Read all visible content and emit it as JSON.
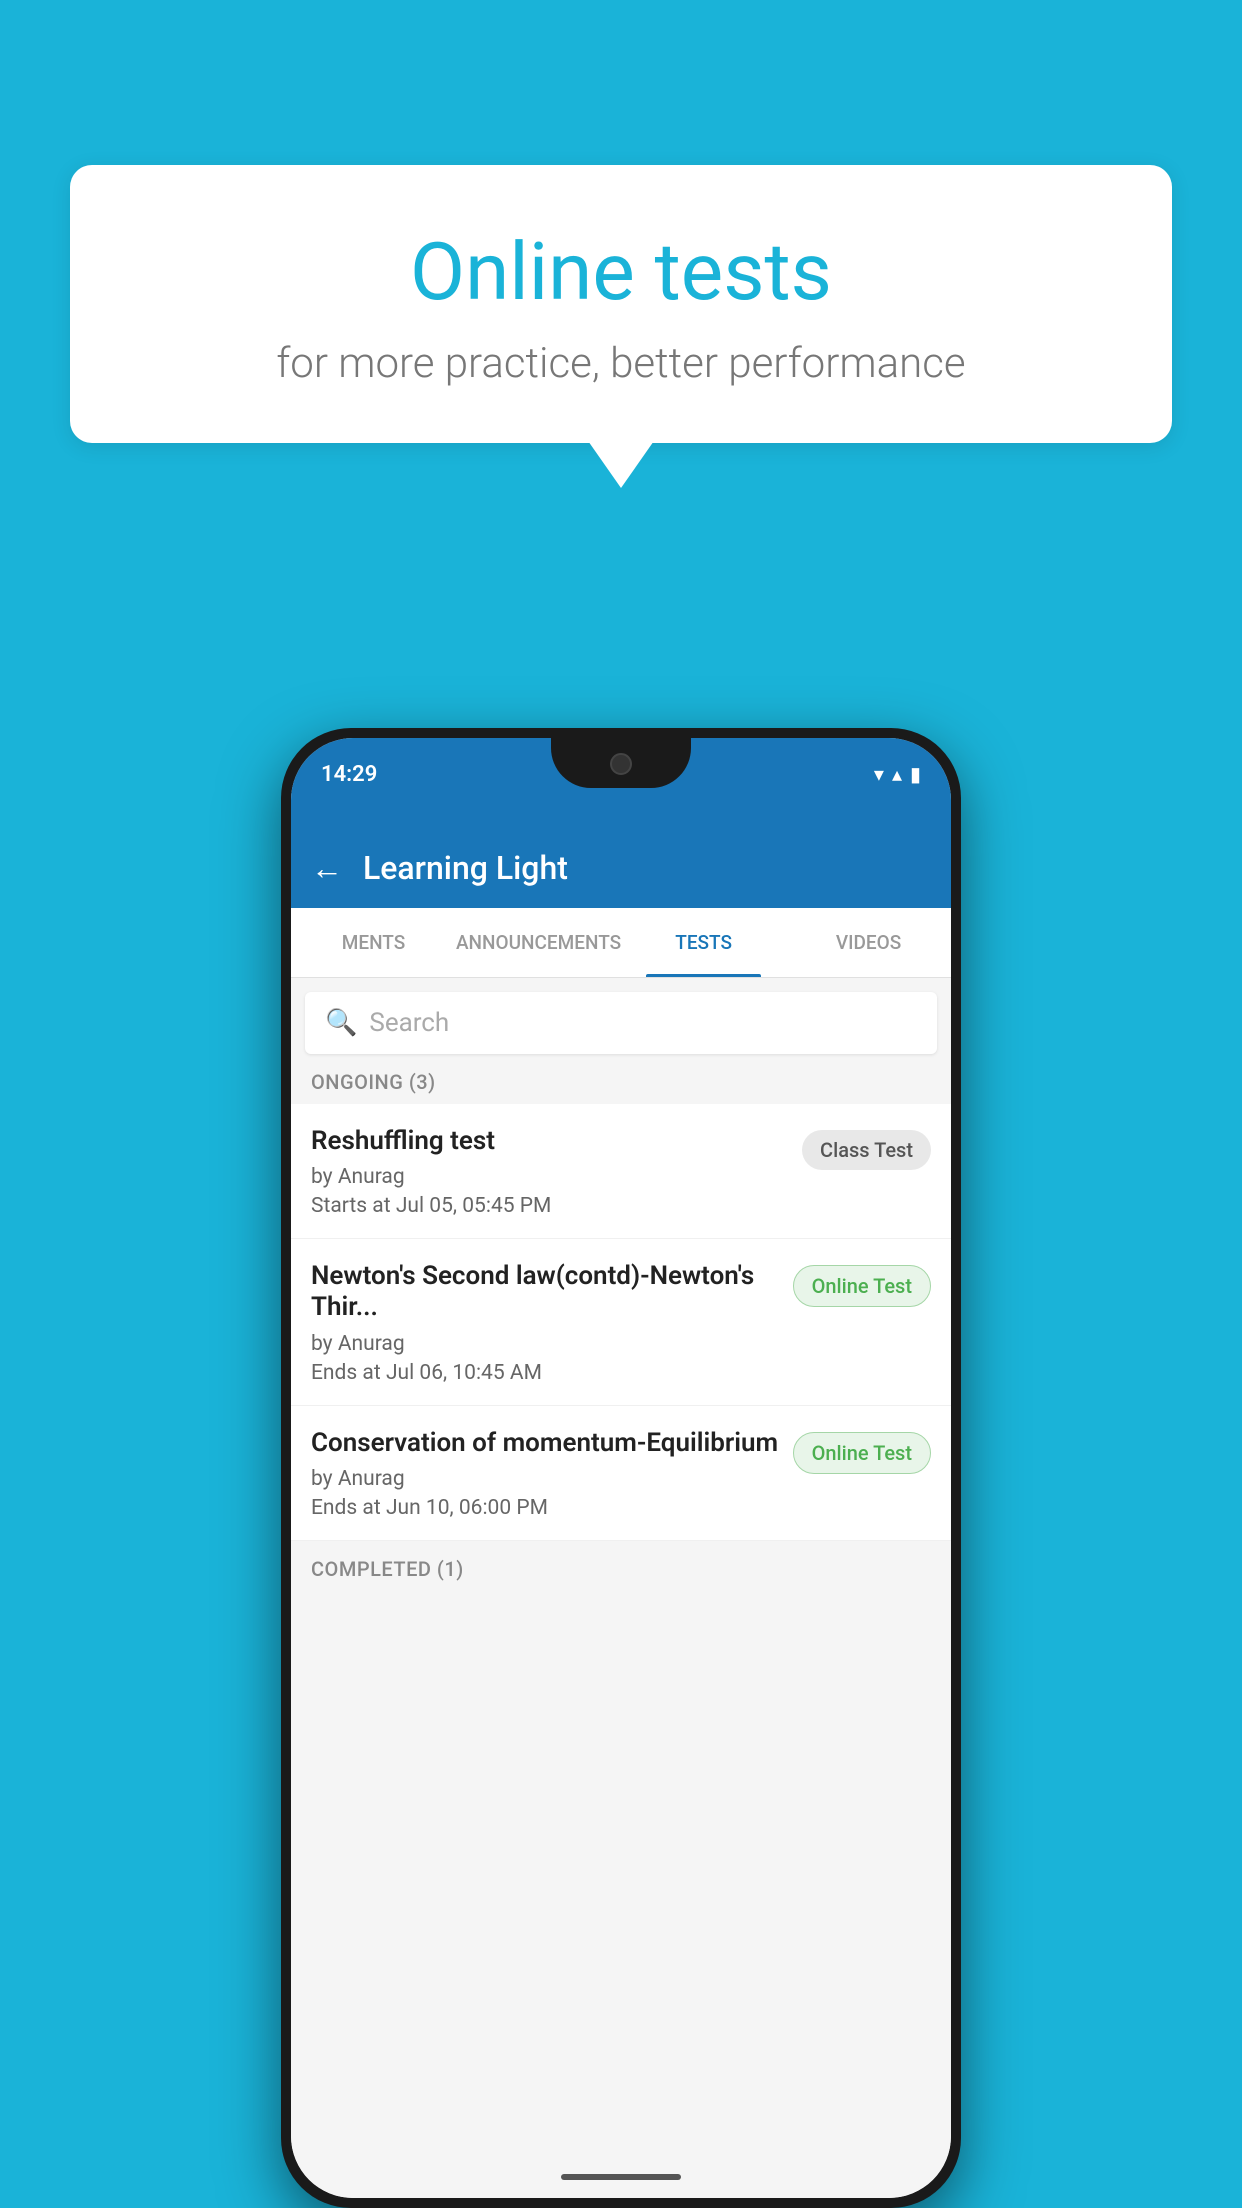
{
  "background_color": "#1ab3d8",
  "bubble": {
    "title": "Online tests",
    "subtitle": "for more practice, better performance"
  },
  "phone": {
    "status_bar": {
      "time": "14:29",
      "wifi": "▼",
      "signal": "▲",
      "battery": "■"
    },
    "app_bar": {
      "title": "Learning Light",
      "back_label": "←"
    },
    "tabs": [
      {
        "label": "MENTS",
        "active": false
      },
      {
        "label": "ANNOUNCEMENTS",
        "active": false
      },
      {
        "label": "TESTS",
        "active": true
      },
      {
        "label": "VIDEOS",
        "active": false
      }
    ],
    "search": {
      "placeholder": "Search"
    },
    "sections": [
      {
        "header": "ONGOING (3)",
        "tests": [
          {
            "name": "Reshuffling test",
            "author": "by Anurag",
            "time_label": "Starts at",
            "time": "Jul 05, 05:45 PM",
            "badge": "Class Test",
            "badge_type": "class"
          },
          {
            "name": "Newton's Second law(contd)-Newton's Thir...",
            "author": "by Anurag",
            "time_label": "Ends at",
            "time": "Jul 06, 10:45 AM",
            "badge": "Online Test",
            "badge_type": "online"
          },
          {
            "name": "Conservation of momentum-Equilibrium",
            "author": "by Anurag",
            "time_label": "Ends at",
            "time": "Jun 10, 06:00 PM",
            "badge": "Online Test",
            "badge_type": "online"
          }
        ]
      },
      {
        "header": "COMPLETED (1)",
        "tests": []
      }
    ]
  }
}
